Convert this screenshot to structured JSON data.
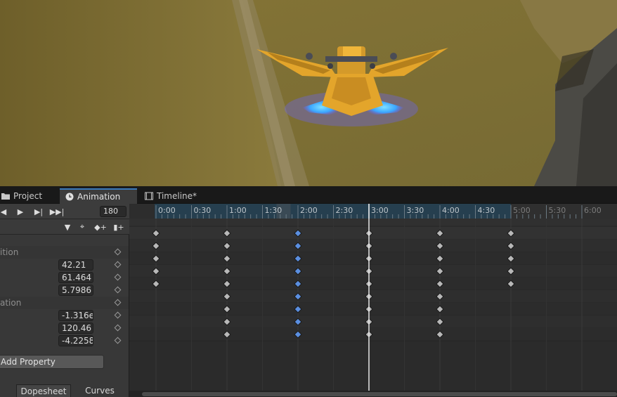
{
  "tabs": [
    {
      "label": "Project",
      "icon": "folder-icon"
    },
    {
      "label": "Animation",
      "icon": "clock-icon",
      "active": true
    },
    {
      "label": "Timeline*",
      "icon": "film-icon"
    }
  ],
  "playback": {
    "frame": "180",
    "buttons": [
      "previous-key-button",
      "play-button",
      "next-key-button",
      "last-frame-button"
    ]
  },
  "properties": {
    "groups": [
      {
        "label": "ition",
        "values": [
          "42.21",
          "61.464",
          "5.7986"
        ]
      },
      {
        "label": "ation",
        "values": [
          "-1.316e",
          "120.46",
          "-4.2258"
        ]
      }
    ],
    "add_property_label": "Add Property"
  },
  "mode_tabs": [
    {
      "label": "Dopesheet",
      "active": true
    },
    {
      "label": "Curves",
      "active": false
    }
  ],
  "ruler": {
    "labels": [
      "0:00",
      "0:30",
      "1:00",
      "1:30",
      "2:00",
      "2:30",
      "3:00",
      "3:30",
      "4:00",
      "4:30",
      "5:00",
      "5:30",
      "6:00"
    ],
    "playhead_time": "3:00"
  },
  "dopesheet": {
    "key_times": [
      "0:00",
      "1:00",
      "2:00",
      "3:00",
      "4:00",
      "5:00"
    ],
    "selected_time": "2:00",
    "rows": [
      {
        "role": "summary",
        "keys": [
          "0:00",
          "1:00",
          "2:00",
          "3:00",
          "4:00",
          "5:00"
        ]
      },
      {
        "role": "position",
        "keys": [
          "0:00",
          "1:00",
          "2:00",
          "3:00",
          "4:00",
          "5:00"
        ]
      },
      {
        "role": "position.x",
        "keys": [
          "0:00",
          "1:00",
          "2:00",
          "3:00",
          "4:00",
          "5:00"
        ]
      },
      {
        "role": "position.y",
        "keys": [
          "0:00",
          "1:00",
          "2:00",
          "3:00",
          "4:00",
          "5:00"
        ]
      },
      {
        "role": "position.z",
        "keys": [
          "0:00",
          "1:00",
          "2:00",
          "3:00",
          "4:00",
          "5:00"
        ]
      },
      {
        "role": "rotation",
        "keys": [
          "1:00",
          "2:00",
          "3:00",
          "4:00"
        ]
      },
      {
        "role": "rotation.x",
        "keys": [
          "1:00",
          "2:00",
          "3:00",
          "4:00"
        ]
      },
      {
        "role": "rotation.y",
        "keys": [
          "1:00",
          "2:00",
          "3:00",
          "4:00"
        ]
      },
      {
        "role": "rotation.z",
        "keys": [
          "1:00",
          "2:00",
          "3:00",
          "4:00"
        ]
      }
    ]
  },
  "colors": {
    "accent_blue": "#3a79bb",
    "key_selected": "#5b8fe0",
    "key_normal": "#b8b8b8",
    "ship_gold": "#e3a52b",
    "thruster_glow": "#4fc3ff"
  }
}
